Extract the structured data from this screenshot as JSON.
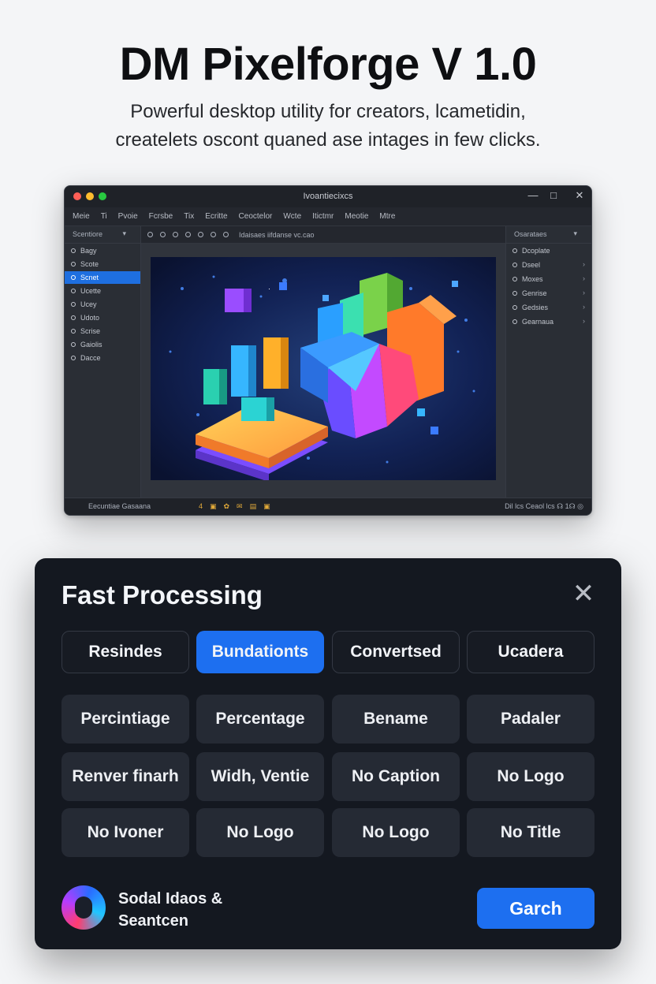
{
  "hero": {
    "title": "DM Pixelforge V 1.0",
    "subtitle_line1": "Powerful desktop utility for creators, lcametidin,",
    "subtitle_line2": "createlets oscont quaned ase intages in few clicks."
  },
  "window": {
    "title": "Ivoantiecixcs",
    "menu": [
      "Meie",
      "Ti",
      "Pvoie",
      "Fcrsbe",
      "Tix",
      "Ecritte",
      "Ceoctelor",
      "Wcte",
      "Itictmr",
      "Meotie",
      "Mtre"
    ],
    "toolbar_label": "Idaisaes iifdanse vc.cao",
    "left_sidebar": {
      "header": "Scentiore",
      "items": [
        {
          "label": "Bagy",
          "active": false
        },
        {
          "label": "Scote",
          "active": false
        },
        {
          "label": "Scnet",
          "active": true
        },
        {
          "label": "Ucette",
          "active": false
        },
        {
          "label": "Ucey",
          "active": false
        },
        {
          "label": "Udoto",
          "active": false
        },
        {
          "label": "Scrise",
          "active": false
        },
        {
          "label": "Gaiolis",
          "active": false
        },
        {
          "label": "Dacce",
          "active": false
        }
      ]
    },
    "right_sidebar": {
      "header": "Osarataes",
      "items": [
        "Dcoplate",
        "Dseel",
        "Moxes",
        "Genrise",
        "Gedsies",
        "Gearnaua"
      ]
    },
    "status": {
      "left": "Eecuntiae Gasaana",
      "icons": "4▣✿✉▤▣",
      "right": "Dil lcs Ceaol lcs ☊ 1☊ ◎"
    }
  },
  "dialog": {
    "title": "Fast Processing",
    "close_icon": "close-icon",
    "tabs": [
      {
        "label": "Resindes",
        "active": false
      },
      {
        "label": "Bundationts",
        "active": true
      },
      {
        "label": "Convertsed",
        "active": false
      },
      {
        "label": "Ucadera",
        "active": false
      }
    ],
    "options": [
      [
        "Percintiage",
        "Percentage",
        "Bename",
        "Padaler"
      ],
      [
        "Renver finarh",
        "Widh, Ventie",
        "No Caption",
        "No Logo"
      ],
      [
        "No Ivoner",
        "No Logo",
        "No Logo",
        "No Title"
      ]
    ],
    "brand_line1": "Sodal Idaos &",
    "brand_line2": "Seantcen",
    "primary_button": "Garch"
  },
  "colors": {
    "accent": "#1d6ff0",
    "dialog_bg": "#141820",
    "window_bg": "#24272e",
    "page_bg": "#f4f5f7"
  }
}
